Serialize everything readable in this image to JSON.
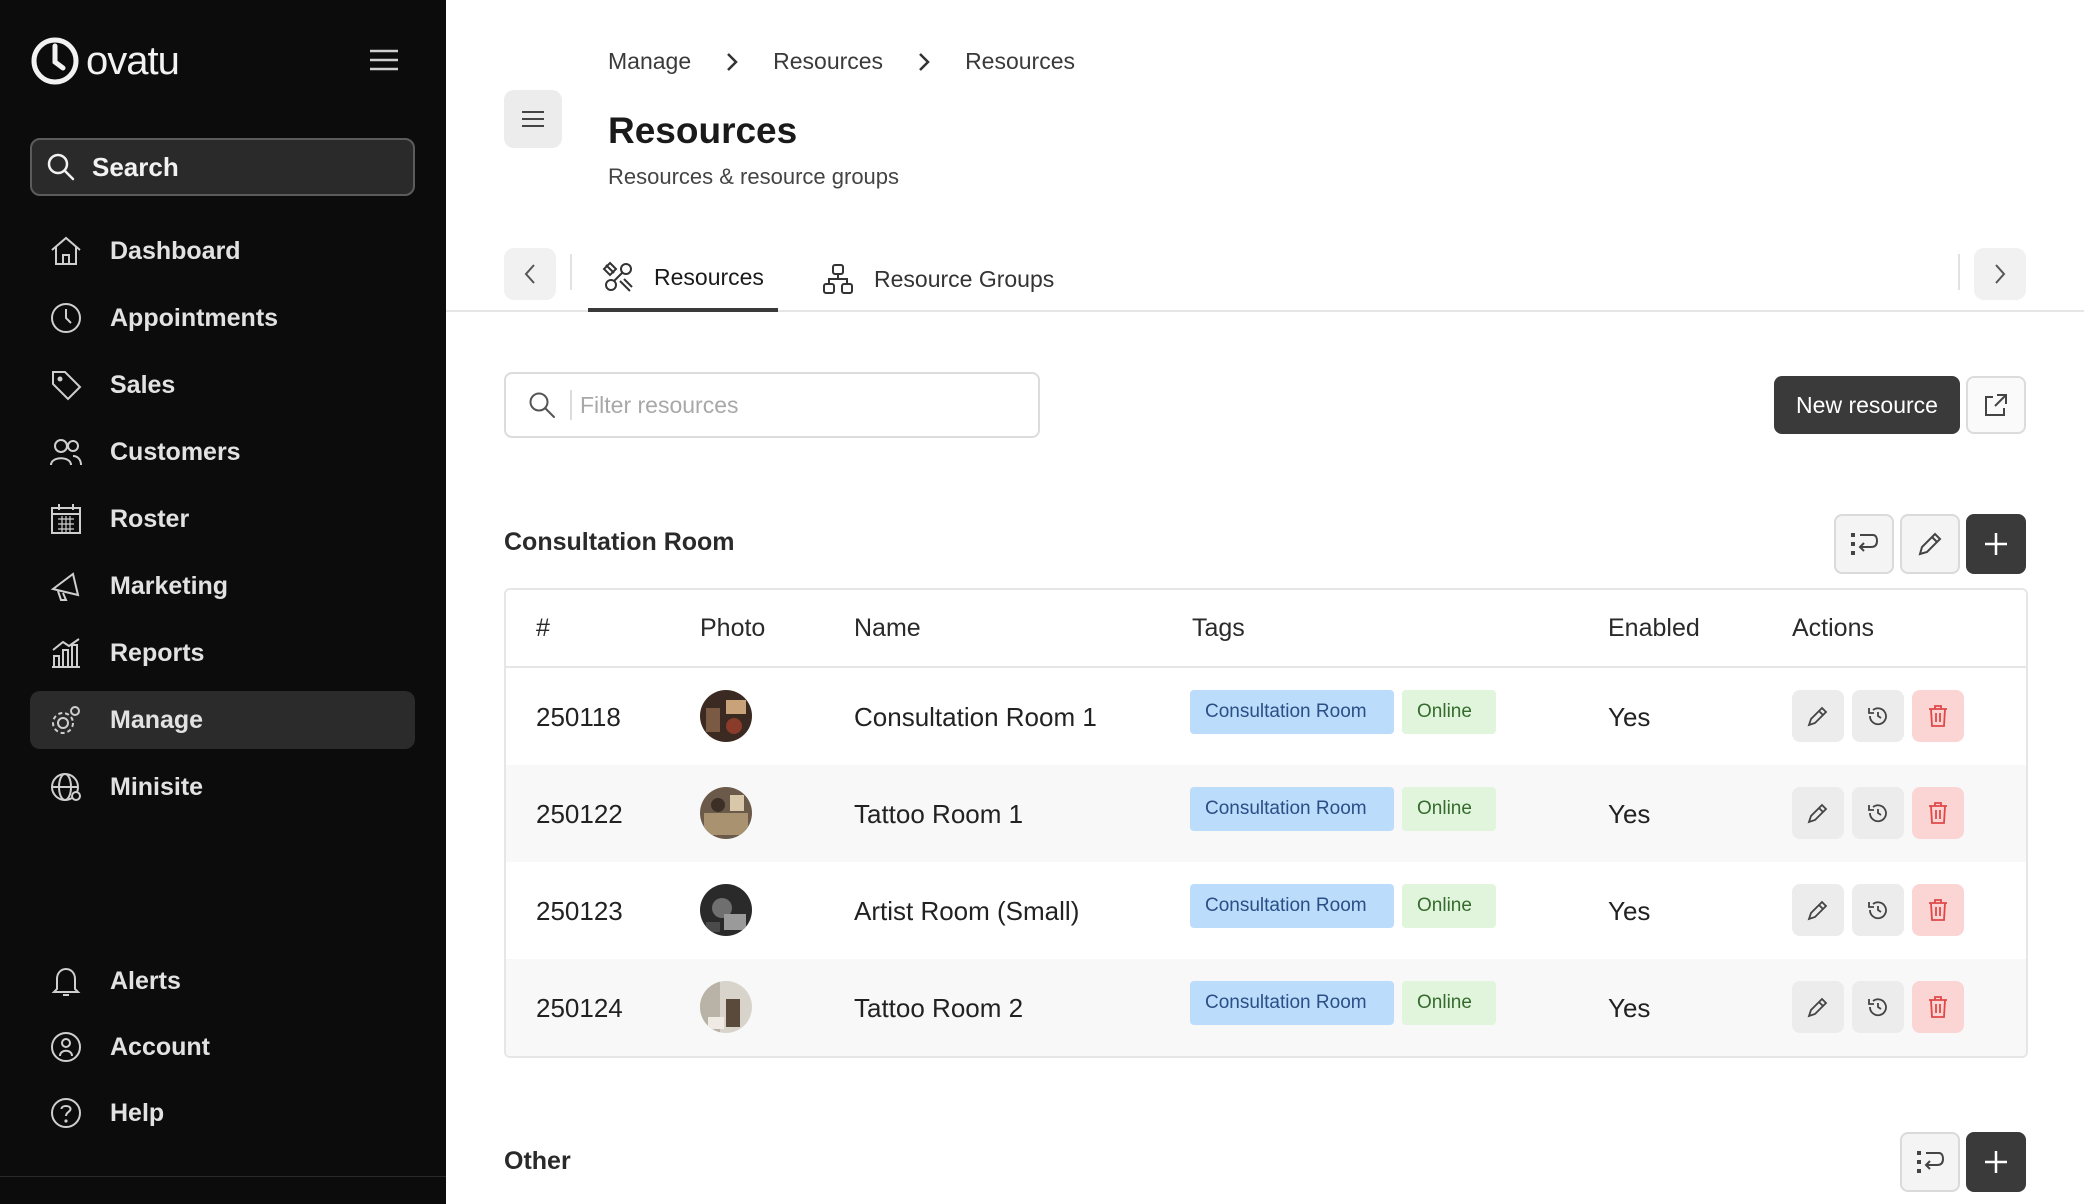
{
  "sidebar": {
    "logo_text": "ovatu",
    "search_label": "Search",
    "nav_items": [
      {
        "label": "Dashboard",
        "icon": "home-icon"
      },
      {
        "label": "Appointments",
        "icon": "clock-icon"
      },
      {
        "label": "Sales",
        "icon": "tag-icon"
      },
      {
        "label": "Customers",
        "icon": "users-icon"
      },
      {
        "label": "Roster",
        "icon": "calendar-icon"
      },
      {
        "label": "Marketing",
        "icon": "megaphone-icon"
      },
      {
        "label": "Reports",
        "icon": "chart-icon"
      },
      {
        "label": "Manage",
        "icon": "gear-icon",
        "active": true
      },
      {
        "label": "Minisite",
        "icon": "globe-icon"
      }
    ],
    "bottom_items": [
      {
        "label": "Alerts",
        "icon": "bell-icon"
      },
      {
        "label": "Account",
        "icon": "account-icon"
      },
      {
        "label": "Help",
        "icon": "help-icon"
      }
    ]
  },
  "header": {
    "breadcrumb": [
      "Manage",
      "Resources",
      "Resources"
    ],
    "title": "Resources",
    "subtitle": "Resources & resource groups"
  },
  "tabs": [
    {
      "label": "Resources",
      "active": true
    },
    {
      "label": "Resource Groups",
      "active": false
    }
  ],
  "toolbar": {
    "filter_placeholder": "Filter resources",
    "new_resource_label": "New resource"
  },
  "sections": [
    {
      "title": "Consultation Room",
      "columns": [
        "#",
        "Photo",
        "Name",
        "Tags",
        "Enabled",
        "Actions"
      ],
      "rows": [
        {
          "id": "250118",
          "name": "Consultation Room 1",
          "tags": [
            "Consultation Room",
            "Online"
          ],
          "enabled": "Yes"
        },
        {
          "id": "250122",
          "name": "Tattoo Room 1",
          "tags": [
            "Consultation Room",
            "Online"
          ],
          "enabled": "Yes"
        },
        {
          "id": "250123",
          "name": "Artist Room (Small)",
          "tags": [
            "Consultation Room",
            "Online"
          ],
          "enabled": "Yes"
        },
        {
          "id": "250124",
          "name": "Tattoo Room 2",
          "tags": [
            "Consultation Room",
            "Online"
          ],
          "enabled": "Yes"
        }
      ]
    },
    {
      "title": "Other"
    }
  ],
  "colors": {
    "sidebar_bg": "#0c0c0c",
    "primary_button": "#3a3a3a",
    "tag_blue": "#bcdcfb",
    "tag_green": "#e0f5dc",
    "delete_bg": "#fbd4d4"
  }
}
